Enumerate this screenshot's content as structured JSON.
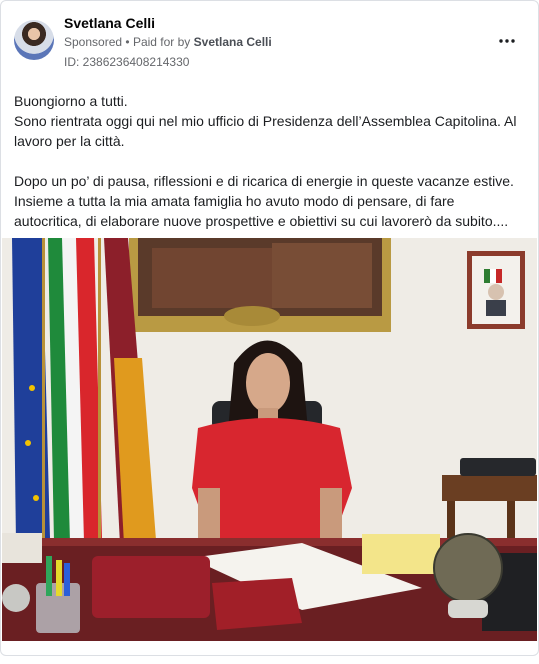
{
  "post": {
    "author": "Svetlana Celli",
    "sponsored_label": "Sponsored",
    "separator": "•",
    "paid_for_prefix": "Paid for by",
    "payer": "Svetlana Celli",
    "ad_id": "ID: 2386236408214330",
    "more_icon": "more-horizontal-icon",
    "text": {
      "line1": "Buongiorno a tutti.",
      "line2": "Sono rientrata oggi qui nel mio ufficio di Presidenza dell’Assemblea Capitolina. Al lavoro per la città.",
      "line3": "Dopo un po’ di pausa, riflessioni e di ricarica di energie in queste vacanze estive. Insieme a tutta la mia amata famiglia ho avuto modo di pensare, di fare autocritica, di elaborare nuove prospettive e obiettivi su cui lavorerò da subito...."
    }
  },
  "colors": {
    "text": "#1c1e21",
    "muted": "#65676b",
    "border": "#dcdfe4",
    "wall": "#ece9e3",
    "dress": "#d8262f"
  }
}
